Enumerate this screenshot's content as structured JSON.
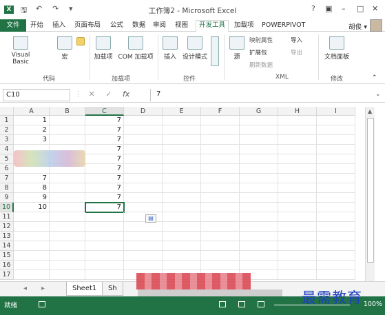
{
  "window": {
    "title": "工作簿2 - Microsoft Excel",
    "help": "?",
    "restore_ribbon": "▣",
    "minimize": "–",
    "maximize": "□",
    "close": "✕"
  },
  "quick_access": {
    "save": "🖫",
    "undo": "↶",
    "redo": "↷",
    "more": "▾"
  },
  "tabs": [
    "开始",
    "插入",
    "页面布局",
    "公式",
    "数据",
    "审阅",
    "视图",
    "开发工具",
    "加载项",
    "POWERPIVOT"
  ],
  "file_tab": "文件",
  "active_tab": "开发工具",
  "user": "胡俊 ▾",
  "ribbon": {
    "code": {
      "label": "代码",
      "visual_basic": "Visual Basic",
      "macro": "宏"
    },
    "addins": {
      "label": "加载项",
      "addins_btn": "加载项",
      "com_addins": "COM 加载项"
    },
    "controls": {
      "label": "控件",
      "insert": "插入",
      "design_mode": "设计模式"
    },
    "xml": {
      "label": "XML",
      "source": "源",
      "map_props": "映射属性",
      "expansion": "扩展包",
      "refresh": "刷新数据",
      "import": "导入",
      "export": "导出"
    },
    "modify": {
      "label": "修改",
      "doc_panel": "文档面板"
    }
  },
  "formula_bar": {
    "name_box": "C10",
    "cancel": "✕",
    "enter": "✓",
    "fx": "fx",
    "value": "7"
  },
  "grid": {
    "columns": [
      "A",
      "B",
      "C",
      "D",
      "E",
      "F",
      "G",
      "H",
      "I"
    ],
    "rows": [
      "1",
      "2",
      "3",
      "4",
      "5",
      "6",
      "7",
      "8",
      "9",
      "10",
      "11",
      "12",
      "13",
      "14",
      "15",
      "16",
      "17"
    ],
    "col_a": [
      "1",
      "2",
      "3",
      "",
      "",
      "",
      "7",
      "8",
      "9",
      "10",
      "",
      "",
      "",
      "",
      "",
      "",
      ""
    ],
    "col_c": [
      "7",
      "7",
      "7",
      "7",
      "7",
      "7",
      "7",
      "7",
      "7",
      "7",
      "",
      "",
      "",
      "",
      "",
      "",
      ""
    ],
    "selected_cell": "C10"
  },
  "sheets": {
    "nav_prev": "◂",
    "nav_next": "▸",
    "tabs": [
      "Sheet1",
      "Sh"
    ]
  },
  "status": {
    "ready": "就绪",
    "zoom": "100%"
  },
  "watermark": "最需教育"
}
